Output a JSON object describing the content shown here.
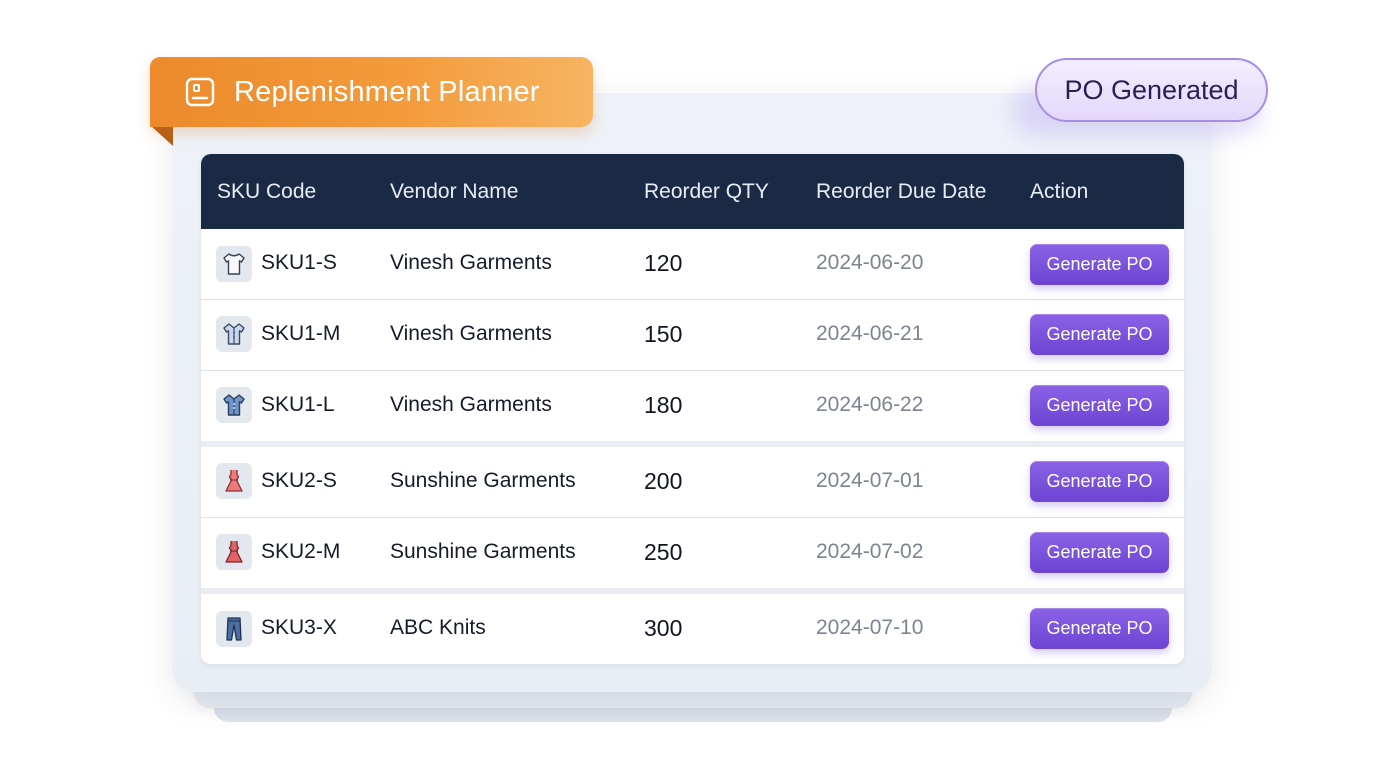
{
  "header": {
    "title": "Replenishment Planner",
    "title_icon": "inventory-box-icon",
    "badge": "PO Generated"
  },
  "colors": {
    "title_tab": "#f0902f",
    "badge_border": "#a88de8",
    "table_header": "#1b2a44",
    "button": "#7a52dc"
  },
  "table": {
    "columns": [
      "SKU Code",
      "Vendor Name",
      "Reorder QTY",
      "Reorder Due Date",
      "Action"
    ],
    "rows": [
      {
        "sku": "SKU1-S",
        "icon": "tshirt-icon",
        "vendor": "Vinesh Garments",
        "qty": "120",
        "due": "2024-06-20",
        "action": "Generate PO"
      },
      {
        "sku": "SKU1-M",
        "icon": "shirt-icon",
        "vendor": "Vinesh Garments",
        "qty": "150",
        "due": "2024-06-21",
        "action": "Generate PO"
      },
      {
        "sku": "SKU1-L",
        "icon": "shirt-icon",
        "vendor": "Vinesh Garments",
        "qty": "180",
        "due": "2024-06-22",
        "action": "Generate PO"
      },
      {
        "sku": "SKU2-S",
        "icon": "dress-icon",
        "vendor": "Sunshine Garments",
        "qty": "200",
        "due": "2024-07-01",
        "action": "Generate PO"
      },
      {
        "sku": "SKU2-M",
        "icon": "dress-icon",
        "vendor": "Sunshine Garments",
        "qty": "250",
        "due": "2024-07-02",
        "action": "Generate PO"
      },
      {
        "sku": "SKU3-X",
        "icon": "jeans-icon",
        "vendor": "ABC Knits",
        "qty": "300",
        "due": "2024-07-10",
        "action": "Generate PO"
      }
    ]
  }
}
